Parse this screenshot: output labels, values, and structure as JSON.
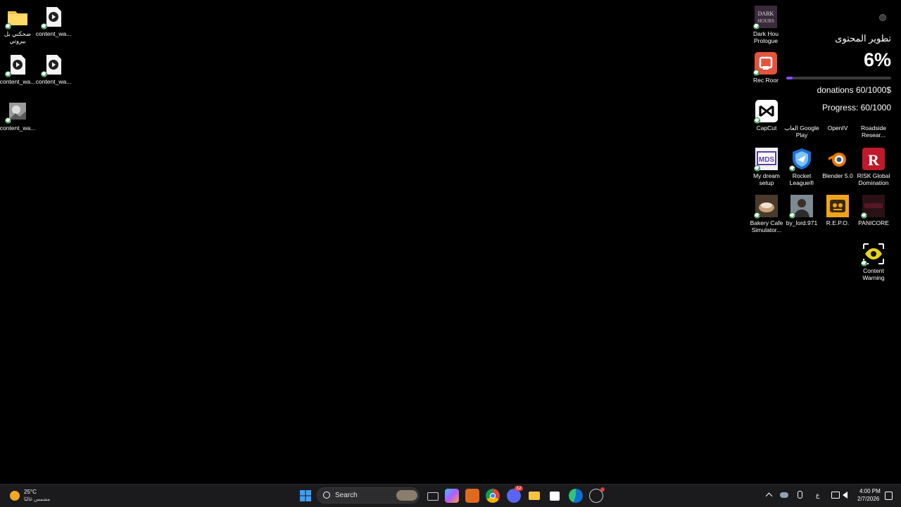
{
  "desktop_left": [
    {
      "label": "ضحكني بل بيروتي",
      "icon": "folder-icon",
      "color": "#f1c24a"
    },
    {
      "label": "content_wa...",
      "icon": "video-file-icon"
    },
    {
      "label": "content_wa...",
      "icon": "video-file-icon"
    },
    {
      "label": "content_wa...",
      "icon": "video-file-icon"
    },
    {
      "label": "content_wa...",
      "icon": "image-file-icon"
    }
  ],
  "desktop_right": [
    {
      "label": "Dark Hou Prologue",
      "icon": "dark-house-icon"
    },
    {
      "label": "Rec Roor",
      "icon": "rec-room-icon",
      "color": "#e5533c"
    },
    {
      "label": "CapCut",
      "icon": "capcut-icon"
    },
    {
      "label": "العاب Google Play",
      "icon": "google-play-games-icon"
    },
    {
      "label": "OpenIV",
      "icon": "openiv-icon"
    },
    {
      "label": "Roadside Resear...",
      "icon": "roadside-research-icon"
    },
    {
      "label": "My dream setup",
      "icon": "my-dream-setup-icon"
    },
    {
      "label": "Rocket League®",
      "icon": "rocket-league-icon",
      "color": "#1e6fd0"
    },
    {
      "label": "Blender 5.0",
      "icon": "blender-icon",
      "color": "#ea7600"
    },
    {
      "label": "RISK Global Domination",
      "icon": "risk-icon",
      "color": "#c0192b"
    },
    {
      "label": "Bakery Cafe Simulator...",
      "icon": "bakery-cafe-icon"
    },
    {
      "label": "by_lord.971",
      "icon": "profile-photo-icon"
    },
    {
      "label": "R.E.P.O.",
      "icon": "repo-icon",
      "color": "#f0a31c"
    },
    {
      "label": "PANICORE",
      "icon": "panicore-icon"
    },
    {
      "label": "Content Warning",
      "icon": "content-warning-icon",
      "color": "#e8d21a"
    }
  ],
  "widget": {
    "title": "تطوير المحتوى",
    "percent_text": "6%",
    "progress": 0.06,
    "progress_color": "#8a4dff",
    "donations": "donations 60/1000$",
    "progress_text": "Progress: 60/1000"
  },
  "taskbar": {
    "weather_temp": "25°C",
    "weather_desc": "مشمس غالبًا",
    "search_placeholder": "Search",
    "apps": [
      "start-icon",
      "task-view-icon",
      "copilot-icon",
      "app-icon",
      "chrome-icon",
      "discord-icon",
      "file-explorer-icon",
      "store-icon",
      "edge-icon",
      "steam-icon"
    ],
    "discord_badge": "32",
    "keyboard_lang": "ع",
    "time": "4:00 PM",
    "date": "2/7/2026"
  }
}
